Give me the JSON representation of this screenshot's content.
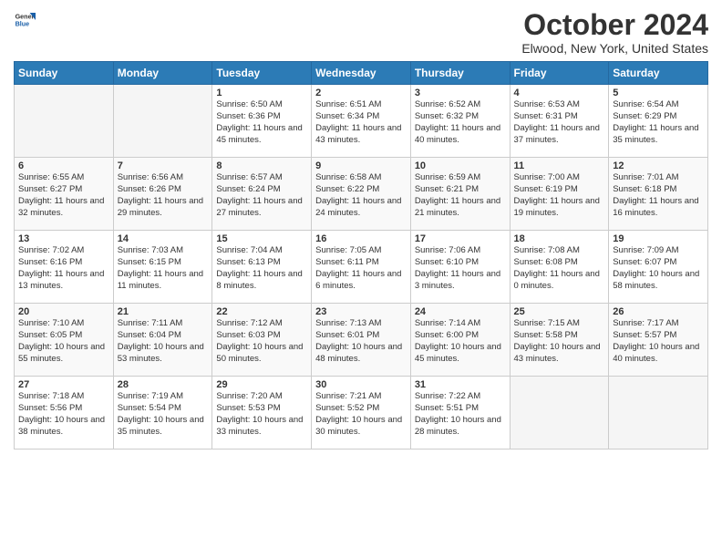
{
  "header": {
    "logo_general": "General",
    "logo_blue": "Blue",
    "title": "October 2024",
    "location": "Elwood, New York, United States"
  },
  "columns": [
    "Sunday",
    "Monday",
    "Tuesday",
    "Wednesday",
    "Thursday",
    "Friday",
    "Saturday"
  ],
  "weeks": [
    [
      {
        "day": "",
        "empty": true
      },
      {
        "day": "",
        "empty": true
      },
      {
        "day": "1",
        "sunrise": "6:50 AM",
        "sunset": "6:36 PM",
        "daylight": "11 hours and 45 minutes."
      },
      {
        "day": "2",
        "sunrise": "6:51 AM",
        "sunset": "6:34 PM",
        "daylight": "11 hours and 43 minutes."
      },
      {
        "day": "3",
        "sunrise": "6:52 AM",
        "sunset": "6:32 PM",
        "daylight": "11 hours and 40 minutes."
      },
      {
        "day": "4",
        "sunrise": "6:53 AM",
        "sunset": "6:31 PM",
        "daylight": "11 hours and 37 minutes."
      },
      {
        "day": "5",
        "sunrise": "6:54 AM",
        "sunset": "6:29 PM",
        "daylight": "11 hours and 35 minutes."
      }
    ],
    [
      {
        "day": "6",
        "sunrise": "6:55 AM",
        "sunset": "6:27 PM",
        "daylight": "11 hours and 32 minutes."
      },
      {
        "day": "7",
        "sunrise": "6:56 AM",
        "sunset": "6:26 PM",
        "daylight": "11 hours and 29 minutes."
      },
      {
        "day": "8",
        "sunrise": "6:57 AM",
        "sunset": "6:24 PM",
        "daylight": "11 hours and 27 minutes."
      },
      {
        "day": "9",
        "sunrise": "6:58 AM",
        "sunset": "6:22 PM",
        "daylight": "11 hours and 24 minutes."
      },
      {
        "day": "10",
        "sunrise": "6:59 AM",
        "sunset": "6:21 PM",
        "daylight": "11 hours and 21 minutes."
      },
      {
        "day": "11",
        "sunrise": "7:00 AM",
        "sunset": "6:19 PM",
        "daylight": "11 hours and 19 minutes."
      },
      {
        "day": "12",
        "sunrise": "7:01 AM",
        "sunset": "6:18 PM",
        "daylight": "11 hours and 16 minutes."
      }
    ],
    [
      {
        "day": "13",
        "sunrise": "7:02 AM",
        "sunset": "6:16 PM",
        "daylight": "11 hours and 13 minutes."
      },
      {
        "day": "14",
        "sunrise": "7:03 AM",
        "sunset": "6:15 PM",
        "daylight": "11 hours and 11 minutes."
      },
      {
        "day": "15",
        "sunrise": "7:04 AM",
        "sunset": "6:13 PM",
        "daylight": "11 hours and 8 minutes."
      },
      {
        "day": "16",
        "sunrise": "7:05 AM",
        "sunset": "6:11 PM",
        "daylight": "11 hours and 6 minutes."
      },
      {
        "day": "17",
        "sunrise": "7:06 AM",
        "sunset": "6:10 PM",
        "daylight": "11 hours and 3 minutes."
      },
      {
        "day": "18",
        "sunrise": "7:08 AM",
        "sunset": "6:08 PM",
        "daylight": "11 hours and 0 minutes."
      },
      {
        "day": "19",
        "sunrise": "7:09 AM",
        "sunset": "6:07 PM",
        "daylight": "10 hours and 58 minutes."
      }
    ],
    [
      {
        "day": "20",
        "sunrise": "7:10 AM",
        "sunset": "6:05 PM",
        "daylight": "10 hours and 55 minutes."
      },
      {
        "day": "21",
        "sunrise": "7:11 AM",
        "sunset": "6:04 PM",
        "daylight": "10 hours and 53 minutes."
      },
      {
        "day": "22",
        "sunrise": "7:12 AM",
        "sunset": "6:03 PM",
        "daylight": "10 hours and 50 minutes."
      },
      {
        "day": "23",
        "sunrise": "7:13 AM",
        "sunset": "6:01 PM",
        "daylight": "10 hours and 48 minutes."
      },
      {
        "day": "24",
        "sunrise": "7:14 AM",
        "sunset": "6:00 PM",
        "daylight": "10 hours and 45 minutes."
      },
      {
        "day": "25",
        "sunrise": "7:15 AM",
        "sunset": "5:58 PM",
        "daylight": "10 hours and 43 minutes."
      },
      {
        "day": "26",
        "sunrise": "7:17 AM",
        "sunset": "5:57 PM",
        "daylight": "10 hours and 40 minutes."
      }
    ],
    [
      {
        "day": "27",
        "sunrise": "7:18 AM",
        "sunset": "5:56 PM",
        "daylight": "10 hours and 38 minutes."
      },
      {
        "day": "28",
        "sunrise": "7:19 AM",
        "sunset": "5:54 PM",
        "daylight": "10 hours and 35 minutes."
      },
      {
        "day": "29",
        "sunrise": "7:20 AM",
        "sunset": "5:53 PM",
        "daylight": "10 hours and 33 minutes."
      },
      {
        "day": "30",
        "sunrise": "7:21 AM",
        "sunset": "5:52 PM",
        "daylight": "10 hours and 30 minutes."
      },
      {
        "day": "31",
        "sunrise": "7:22 AM",
        "sunset": "5:51 PM",
        "daylight": "10 hours and 28 minutes."
      },
      {
        "day": "",
        "empty": true
      },
      {
        "day": "",
        "empty": true
      }
    ]
  ],
  "labels": {
    "sunrise_prefix": "Sunrise: ",
    "sunset_prefix": "Sunset: ",
    "daylight_prefix": "Daylight: "
  }
}
